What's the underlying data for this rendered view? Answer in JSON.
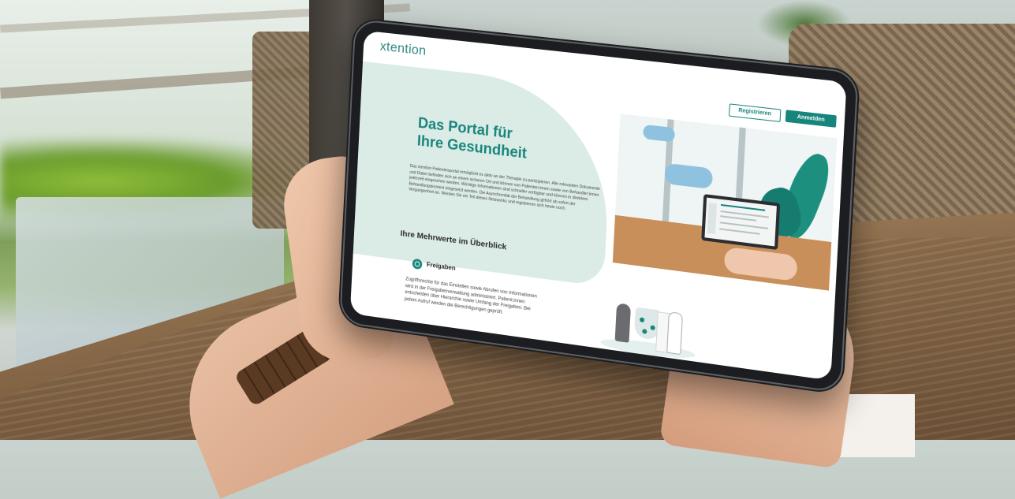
{
  "app": {
    "logo": "xtention"
  },
  "header": {
    "register_label": "Registrieren",
    "login_label": "Anmelden"
  },
  "hero": {
    "title_line1": "Das Portal für",
    "title_line2": "Ihre Gesundheit",
    "body": "Das xtention Patientenportal ermöglicht es aktiv an der Therapie zu partizipieren. Alle relevanten Dokumente und Daten befinden sich an einem sicheren Ort und können von Patienten:innen sowie von Behandler:innen jederzeit eingesehen werden. Wichtige Informationen sind schneller verfügbar und können in direktem Behandlungskontext eingesetzt werden. Die Asynchronität der Behandlung gehört ab sofort der Vergangenheit an. Werden Sie ein Teil dieses Netzwerks und registrieren sich heute noch."
  },
  "benefits": {
    "title": "Ihre Mehrwerte im Überblick",
    "feature": {
      "icon": "share-icon",
      "title": "Freigaben",
      "text": "Zugriffsrechte für das Einstellen sowie Abrufen von Informationen wird in der Freigabenverwaltung administriert. Patient:innen entscheiden über Hierarchie sowie Umfang der Freigaben. Bei jedem Aufruf werden die Berechtigungen geprüft."
    }
  },
  "colors": {
    "brand": "#19857c",
    "hero_bg": "#dbece7"
  }
}
